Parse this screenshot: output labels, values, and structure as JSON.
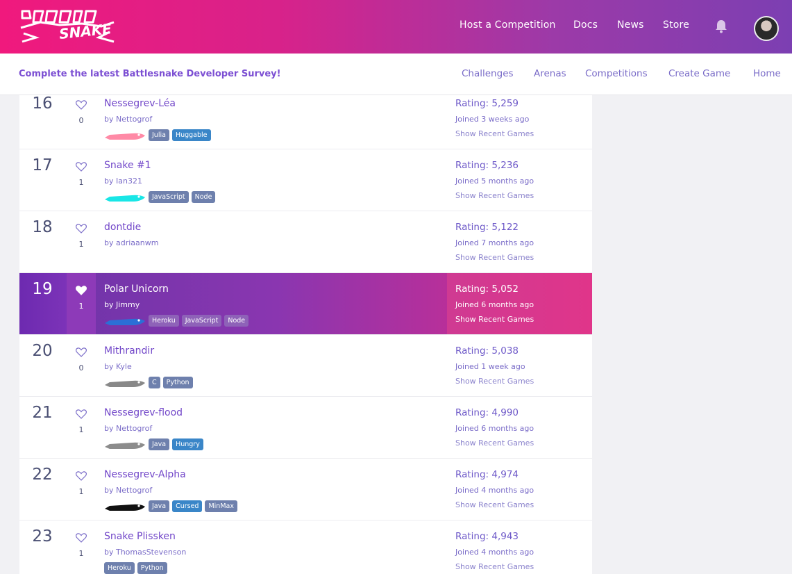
{
  "header": {
    "logo_text": "BATTLESNAKE",
    "nav": [
      "Host a Competition",
      "Docs",
      "News",
      "Store"
    ],
    "notifications_icon": "bell-icon",
    "avatar_icon": "user-avatar"
  },
  "subbar": {
    "survey_link": "Complete the latest Battlesnake Developer Survey!",
    "nav": [
      "Challenges",
      "Arenas",
      "Competitions",
      "Create Game",
      "Home"
    ]
  },
  "colors": {
    "brand_pink": "#f0197d",
    "brand_purple": "#7c3fb2",
    "link_purple": "#7247c9",
    "tag_gray": "#6e80ad",
    "tag_blue": "#3a86c8"
  },
  "leaderboard": [
    {
      "rank": "16",
      "likes": "0",
      "name": "Nessegrev-Léa",
      "owner": "by Nettogrof",
      "snake_color": "#ff8aa6",
      "tags": [
        {
          "label": "Julia",
          "style": "gray"
        },
        {
          "label": "Huggable",
          "style": "blue"
        }
      ],
      "rating": "Rating: 5,259",
      "joined": "Joined 3 weeks ago",
      "recent": "Show Recent Games",
      "highlight": false
    },
    {
      "rank": "17",
      "likes": "1",
      "name": "Snake #1",
      "owner": "by Ian321",
      "snake_color": "#19e6e6",
      "tags": [
        {
          "label": "JavaScript",
          "style": "gray"
        },
        {
          "label": "Node",
          "style": "gray"
        }
      ],
      "rating": "Rating: 5,236",
      "joined": "Joined 5 months ago",
      "recent": "Show Recent Games",
      "highlight": false
    },
    {
      "rank": "18",
      "likes": "1",
      "name": "dontdie",
      "owner": "by adriaanwm",
      "snake_color": "",
      "tags": [],
      "rating": "Rating: 5,122",
      "joined": "Joined 7 months ago",
      "recent": "Show Recent Games",
      "highlight": false
    },
    {
      "rank": "19",
      "likes": "1",
      "name": "Polar Unicorn",
      "owner": "by Jimmy",
      "snake_color": "#2b6fd6",
      "tags": [
        {
          "label": "Heroku",
          "style": "gray"
        },
        {
          "label": "JavaScript",
          "style": "gray"
        },
        {
          "label": "Node",
          "style": "gray"
        }
      ],
      "rating": "Rating: 5,052",
      "joined": "Joined 6 months ago",
      "recent": "Show Recent Games",
      "highlight": true
    },
    {
      "rank": "20",
      "likes": "0",
      "name": "Mithrandir",
      "owner": "by Kyle",
      "snake_color": "#888888",
      "tags": [
        {
          "label": "C",
          "style": "gray"
        },
        {
          "label": "Python",
          "style": "gray"
        }
      ],
      "rating": "Rating: 5,038",
      "joined": "Joined 1 week ago",
      "recent": "Show Recent Games",
      "highlight": false
    },
    {
      "rank": "21",
      "likes": "1",
      "name": "Nessegrev-flood",
      "owner": "by Nettogrof",
      "snake_color": "#8c8c8c",
      "tags": [
        {
          "label": "Java",
          "style": "gray"
        },
        {
          "label": "Hungry",
          "style": "blue"
        }
      ],
      "rating": "Rating: 4,990",
      "joined": "Joined 6 months ago",
      "recent": "Show Recent Games",
      "highlight": false
    },
    {
      "rank": "22",
      "likes": "1",
      "name": "Nessegrev-Alpha",
      "owner": "by Nettogrof",
      "snake_color": "#111111",
      "tags": [
        {
          "label": "Java",
          "style": "gray"
        },
        {
          "label": "Cursed",
          "style": "blue"
        },
        {
          "label": "MinMax",
          "style": "gray"
        }
      ],
      "rating": "Rating: 4,974",
      "joined": "Joined 4 months ago",
      "recent": "Show Recent Games",
      "highlight": false
    },
    {
      "rank": "23",
      "likes": "1",
      "name": "Snake Plissken",
      "owner": "by ThomasStevenson",
      "snake_color": "",
      "tags": [
        {
          "label": "Heroku",
          "style": "gray"
        },
        {
          "label": "Python",
          "style": "gray"
        }
      ],
      "rating": "Rating: 4,943",
      "joined": "Joined 4 months ago",
      "recent": "Show Recent Games",
      "highlight": false
    }
  ]
}
